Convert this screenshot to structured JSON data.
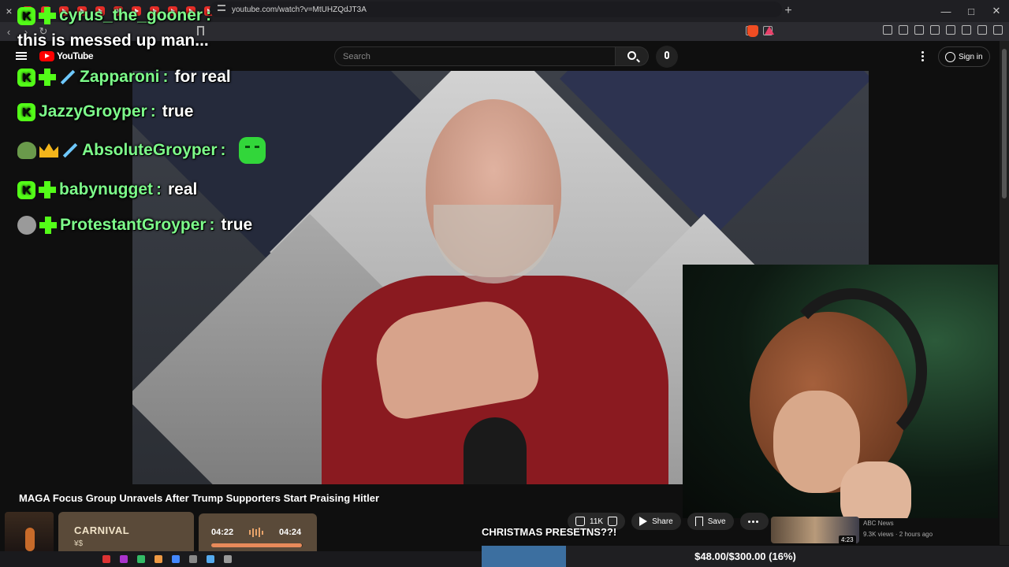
{
  "browser": {
    "url": "youtube.com/watch?v=MtUHZQdJT3A",
    "tab_count": 42
  },
  "header": {
    "logo_text": "YouTube",
    "search_placeholder": "Search",
    "signin_label": "Sign in"
  },
  "chat": [
    {
      "user": "cyrus_the_gooner",
      "text": "this is messed up man...",
      "badges": [
        "k-icon",
        "sub-icon"
      ]
    },
    {
      "user": "Zapparoni",
      "text": "for real",
      "badges": [
        "k-icon",
        "sub-icon",
        "sword-icon"
      ]
    },
    {
      "user": "JazzyGroyper",
      "text": "true",
      "badges": [
        "k-icon"
      ]
    },
    {
      "user": "AbsoluteGroyper",
      "text": "",
      "badges": [
        "turtle-icon",
        "crown-icon",
        "sword-icon"
      ],
      "emote": "pepe-emote"
    },
    {
      "user": "babynugget",
      "text": "real",
      "badges": [
        "k-icon",
        "sub-icon"
      ]
    },
    {
      "user": "ProtestantGroyper",
      "text": "true",
      "badges": [
        "avatar-icon",
        "sub-icon"
      ]
    }
  ],
  "video": {
    "title": "MAGA Focus Group Unravels After Trump Supporters Start Praising Hitler",
    "likes": "11K",
    "share_label": "Share",
    "save_label": "Save"
  },
  "recommended": {
    "channel": "ABC News",
    "meta": "9.3K views · 2 hours ago",
    "duration": "4:23"
  },
  "music": {
    "title": "CARNIVAL",
    "artist": "¥$",
    "current": "04:22",
    "total": "04:24",
    "progress": 0.99
  },
  "alert_text": "CHRISTMAS PRESETNS??!",
  "goal": {
    "text": "$48.00/$300.00 (16%)",
    "fraction": 0.16
  },
  "colors": {
    "chat_username": "#7dfc8a",
    "kick_green": "#53fc18",
    "yt_red": "#ff0000",
    "goal_fill": "#3c6fa0"
  }
}
